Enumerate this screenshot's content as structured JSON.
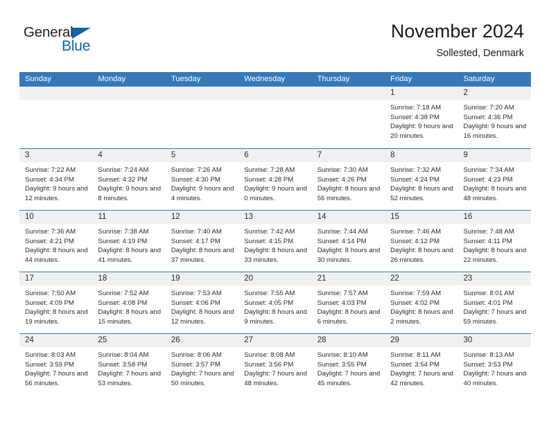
{
  "brand": {
    "word_general": "General",
    "word_blue": "Blue",
    "logo_icon": "triangle-icon",
    "accent_color": "#1464aa"
  },
  "header": {
    "title": "November 2024",
    "subtitle": "Sollested, Denmark"
  },
  "calendar": {
    "header_bg_color": "#3579bb",
    "daynum_bg_color": "#f0f0f0",
    "weekdays": [
      "Sunday",
      "Monday",
      "Tuesday",
      "Wednesday",
      "Thursday",
      "Friday",
      "Saturday"
    ],
    "weeks": [
      [
        {
          "day": "",
          "empty": true
        },
        {
          "day": "",
          "empty": true
        },
        {
          "day": "",
          "empty": true
        },
        {
          "day": "",
          "empty": true
        },
        {
          "day": "",
          "empty": true
        },
        {
          "day": "1",
          "sunrise": "Sunrise: 7:18 AM",
          "sunset": "Sunset: 4:38 PM",
          "daylight": "Daylight: 9 hours and 20 minutes."
        },
        {
          "day": "2",
          "sunrise": "Sunrise: 7:20 AM",
          "sunset": "Sunset: 4:36 PM",
          "daylight": "Daylight: 9 hours and 16 minutes."
        }
      ],
      [
        {
          "day": "3",
          "sunrise": "Sunrise: 7:22 AM",
          "sunset": "Sunset: 4:34 PM",
          "daylight": "Daylight: 9 hours and 12 minutes."
        },
        {
          "day": "4",
          "sunrise": "Sunrise: 7:24 AM",
          "sunset": "Sunset: 4:32 PM",
          "daylight": "Daylight: 9 hours and 8 minutes."
        },
        {
          "day": "5",
          "sunrise": "Sunrise: 7:26 AM",
          "sunset": "Sunset: 4:30 PM",
          "daylight": "Daylight: 9 hours and 4 minutes."
        },
        {
          "day": "6",
          "sunrise": "Sunrise: 7:28 AM",
          "sunset": "Sunset: 4:28 PM",
          "daylight": "Daylight: 9 hours and 0 minutes."
        },
        {
          "day": "7",
          "sunrise": "Sunrise: 7:30 AM",
          "sunset": "Sunset: 4:26 PM",
          "daylight": "Daylight: 8 hours and 56 minutes."
        },
        {
          "day": "8",
          "sunrise": "Sunrise: 7:32 AM",
          "sunset": "Sunset: 4:24 PM",
          "daylight": "Daylight: 8 hours and 52 minutes."
        },
        {
          "day": "9",
          "sunrise": "Sunrise: 7:34 AM",
          "sunset": "Sunset: 4:23 PM",
          "daylight": "Daylight: 8 hours and 48 minutes."
        }
      ],
      [
        {
          "day": "10",
          "sunrise": "Sunrise: 7:36 AM",
          "sunset": "Sunset: 4:21 PM",
          "daylight": "Daylight: 8 hours and 44 minutes."
        },
        {
          "day": "11",
          "sunrise": "Sunrise: 7:38 AM",
          "sunset": "Sunset: 4:19 PM",
          "daylight": "Daylight: 8 hours and 41 minutes."
        },
        {
          "day": "12",
          "sunrise": "Sunrise: 7:40 AM",
          "sunset": "Sunset: 4:17 PM",
          "daylight": "Daylight: 8 hours and 37 minutes."
        },
        {
          "day": "13",
          "sunrise": "Sunrise: 7:42 AM",
          "sunset": "Sunset: 4:15 PM",
          "daylight": "Daylight: 8 hours and 33 minutes."
        },
        {
          "day": "14",
          "sunrise": "Sunrise: 7:44 AM",
          "sunset": "Sunset: 4:14 PM",
          "daylight": "Daylight: 8 hours and 30 minutes."
        },
        {
          "day": "15",
          "sunrise": "Sunrise: 7:46 AM",
          "sunset": "Sunset: 4:12 PM",
          "daylight": "Daylight: 8 hours and 26 minutes."
        },
        {
          "day": "16",
          "sunrise": "Sunrise: 7:48 AM",
          "sunset": "Sunset: 4:11 PM",
          "daylight": "Daylight: 8 hours and 22 minutes."
        }
      ],
      [
        {
          "day": "17",
          "sunrise": "Sunrise: 7:50 AM",
          "sunset": "Sunset: 4:09 PM",
          "daylight": "Daylight: 8 hours and 19 minutes."
        },
        {
          "day": "18",
          "sunrise": "Sunrise: 7:52 AM",
          "sunset": "Sunset: 4:08 PM",
          "daylight": "Daylight: 8 hours and 15 minutes."
        },
        {
          "day": "19",
          "sunrise": "Sunrise: 7:53 AM",
          "sunset": "Sunset: 4:06 PM",
          "daylight": "Daylight: 8 hours and 12 minutes."
        },
        {
          "day": "20",
          "sunrise": "Sunrise: 7:55 AM",
          "sunset": "Sunset: 4:05 PM",
          "daylight": "Daylight: 8 hours and 9 minutes."
        },
        {
          "day": "21",
          "sunrise": "Sunrise: 7:57 AM",
          "sunset": "Sunset: 4:03 PM",
          "daylight": "Daylight: 8 hours and 6 minutes."
        },
        {
          "day": "22",
          "sunrise": "Sunrise: 7:59 AM",
          "sunset": "Sunset: 4:02 PM",
          "daylight": "Daylight: 8 hours and 2 minutes."
        },
        {
          "day": "23",
          "sunrise": "Sunrise: 8:01 AM",
          "sunset": "Sunset: 4:01 PM",
          "daylight": "Daylight: 7 hours and 59 minutes."
        }
      ],
      [
        {
          "day": "24",
          "sunrise": "Sunrise: 8:03 AM",
          "sunset": "Sunset: 3:59 PM",
          "daylight": "Daylight: 7 hours and 56 minutes."
        },
        {
          "day": "25",
          "sunrise": "Sunrise: 8:04 AM",
          "sunset": "Sunset: 3:58 PM",
          "daylight": "Daylight: 7 hours and 53 minutes."
        },
        {
          "day": "26",
          "sunrise": "Sunrise: 8:06 AM",
          "sunset": "Sunset: 3:57 PM",
          "daylight": "Daylight: 7 hours and 50 minutes."
        },
        {
          "day": "27",
          "sunrise": "Sunrise: 8:08 AM",
          "sunset": "Sunset: 3:56 PM",
          "daylight": "Daylight: 7 hours and 48 minutes."
        },
        {
          "day": "28",
          "sunrise": "Sunrise: 8:10 AM",
          "sunset": "Sunset: 3:55 PM",
          "daylight": "Daylight: 7 hours and 45 minutes."
        },
        {
          "day": "29",
          "sunrise": "Sunrise: 8:11 AM",
          "sunset": "Sunset: 3:54 PM",
          "daylight": "Daylight: 7 hours and 42 minutes."
        },
        {
          "day": "30",
          "sunrise": "Sunrise: 8:13 AM",
          "sunset": "Sunset: 3:53 PM",
          "daylight": "Daylight: 7 hours and 40 minutes."
        }
      ]
    ]
  }
}
